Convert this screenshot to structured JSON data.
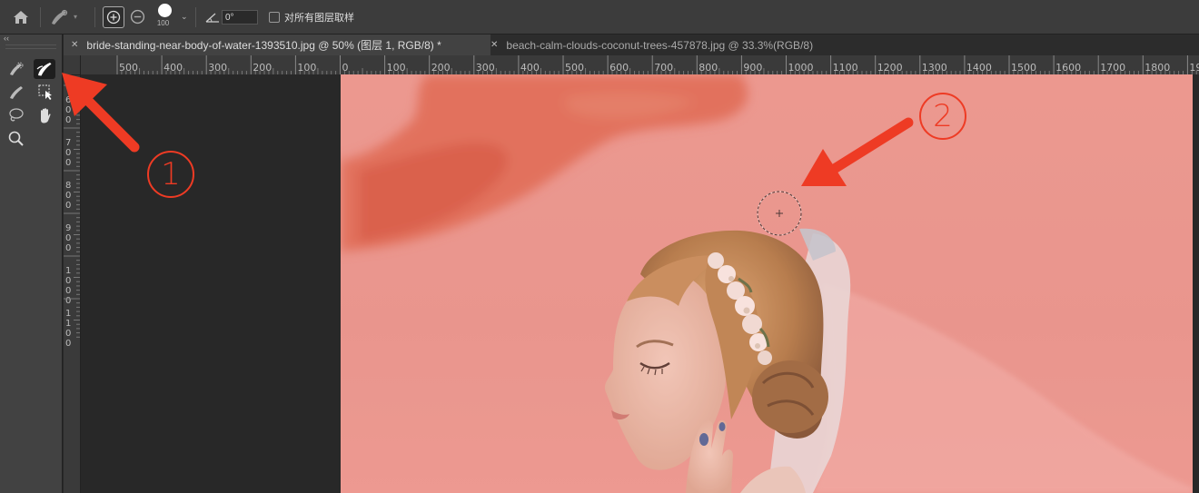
{
  "options_bar": {
    "brush_size": "100",
    "angle_value": "0°",
    "sample_all_layers_label": "对所有图层取样"
  },
  "tabs": [
    {
      "label": "bride-standing-near-body-of-water-1393510.jpg @ 50% (图层 1, RGB/8) *",
      "active": true
    },
    {
      "label": "beach-calm-clouds-coconut-trees-457878.jpg @ 33.3%(RGB/8)",
      "active": false
    }
  ],
  "ruler": {
    "horizontal": [
      "500",
      "400",
      "300",
      "200",
      "100",
      "0",
      "100",
      "200",
      "300",
      "400",
      "500",
      "600",
      "700",
      "800",
      "900",
      "1000",
      "1100",
      "1200",
      "1300",
      "1400",
      "1500",
      "1600",
      "1700",
      "1800",
      "19"
    ],
    "vertical": [
      {
        "chars": [
          "6",
          "0",
          "0"
        ]
      },
      {
        "chars": [
          "7",
          "0",
          "0"
        ]
      },
      {
        "chars": [
          "8",
          "0",
          "0"
        ]
      },
      {
        "chars": [
          "9",
          "0",
          "0"
        ]
      },
      {
        "chars": [
          "1",
          "0",
          "0",
          "0"
        ]
      },
      {
        "chars": [
          "1",
          "1",
          "0",
          "0"
        ]
      }
    ]
  },
  "annotations": {
    "marker1": "1",
    "marker2": "2"
  },
  "colors": {
    "accent_arrow": "#ee3b24",
    "overlay": "#ef8f86"
  }
}
